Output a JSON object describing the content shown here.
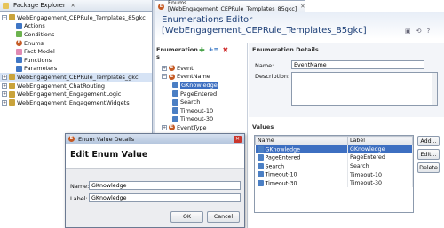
{
  "package_explorer": {
    "title": "Package Explorer",
    "items": [
      {
        "label": "WebEngagement_CEPRule_Templates_85gkc"
      },
      {
        "label": "Actions"
      },
      {
        "label": "Conditions"
      },
      {
        "label": "Enums"
      },
      {
        "label": "Fact Model"
      },
      {
        "label": "Functions"
      },
      {
        "label": "Parameters"
      },
      {
        "label": "WebEngagement_CEPRule_Templates_gkc"
      },
      {
        "label": "WebEngagement_ChatRouting"
      },
      {
        "label": "WebEngagement_EngagementLogic"
      },
      {
        "label": "WebEngagement_EngagementWidgets"
      }
    ]
  },
  "editor": {
    "tab_label": "Enums [WebEngagement_CEPRule_Templates_85gkc]",
    "title_line1": "Enumerations Editor",
    "title_line2": "[WebEngagement_CEPRule_Templates_85gkc]",
    "enumerations_label": "Enumeration s",
    "tree": [
      {
        "label": "Event"
      },
      {
        "label": "EventName"
      },
      {
        "label": "GKnowledge"
      },
      {
        "label": "PageEntered"
      },
      {
        "label": "Search"
      },
      {
        "label": "Timeout-10"
      },
      {
        "label": "Timeout-30"
      },
      {
        "label": "EventType"
      }
    ],
    "details": {
      "title": "Enumeration Details",
      "name_label": "Name:",
      "name_value": "EventName",
      "description_label": "Description:"
    },
    "values": {
      "title": "Values",
      "col_name": "Name",
      "col_label": "Label",
      "rows": [
        {
          "name": "GKnowledge",
          "label": "GKnowledge"
        },
        {
          "name": "PageEntered",
          "label": "PageEntered"
        },
        {
          "name": "Search",
          "label": "Search"
        },
        {
          "name": "Timeout-10",
          "label": "Timeout-10"
        },
        {
          "name": "Timeout-30",
          "label": "Timeout-30"
        }
      ],
      "add_button": "Add...",
      "edit_button": "Edit...",
      "delete_button": "Delete"
    }
  },
  "dialog": {
    "title": "Enum Value Details",
    "heading": "Edit Enum Value",
    "name_label": "Name:",
    "name_value": "GKnowledge",
    "label_label": "Label:",
    "label_value": "GKnowledge",
    "ok_button": "OK",
    "cancel_button": "Cancel"
  },
  "colors": {
    "accent": "#3d6fc1",
    "title": "#1d3f77"
  }
}
